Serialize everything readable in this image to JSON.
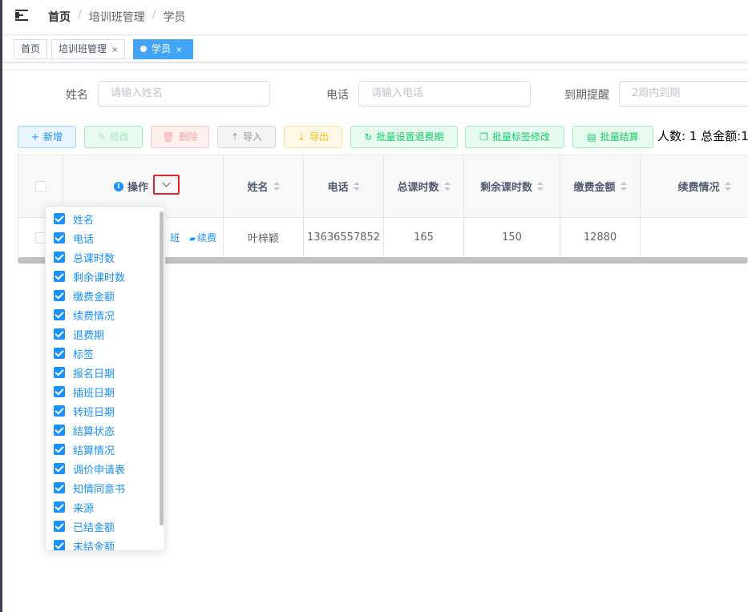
{
  "breadcrumb": [
    "首页",
    "培训班管理",
    "学员"
  ],
  "tags": [
    {
      "label": "首页",
      "closable": false,
      "active": false
    },
    {
      "label": "培训班管理",
      "closable": true,
      "active": false
    },
    {
      "label": "学员",
      "closable": true,
      "active": true
    }
  ],
  "tag_close_glyph": "×",
  "search": {
    "name_label": "姓名",
    "name_placeholder": "请输入姓名",
    "phone_label": "电话",
    "phone_placeholder": "请输入电话",
    "expire_label": "到期提醒",
    "expire_value": "2周内到期"
  },
  "toolbar": {
    "add": "新增",
    "edit": "修改",
    "delete": "删除",
    "import": "导入",
    "export": "导出",
    "batch_refund": "批量设置退费期",
    "batch_tag": "批量标签修改",
    "batch_settle": "批量结算"
  },
  "summary": "人数: 1 总金额:1",
  "table": {
    "headers": {
      "action": "操作",
      "name": "姓名",
      "phone": "电话",
      "total_hours": "总课时数",
      "remaining_hours": "剩余课时数",
      "payment": "缴费金额",
      "renewal": "续费情况"
    },
    "row": {
      "action_partial": "班",
      "action_renew": "续费",
      "name": "叶梓颖",
      "phone": "13636557852",
      "total_hours": "165",
      "remaining_hours": "150",
      "payment": "12880",
      "renewal": ""
    }
  },
  "column_options": [
    "姓名",
    "电话",
    "总课时数",
    "剩余课时数",
    "缴费金额",
    "续费情况",
    "退费期",
    "标签",
    "报名日期",
    "插班日期",
    "转班日期",
    "结算状态",
    "结算情况",
    "调价申请表",
    "知情同意书",
    "来源",
    "已结金额",
    "未结金额"
  ],
  "colors": {
    "primary": "#1890ff",
    "active_tag": "#42a4f5",
    "highlight_box": "#e8212a"
  }
}
